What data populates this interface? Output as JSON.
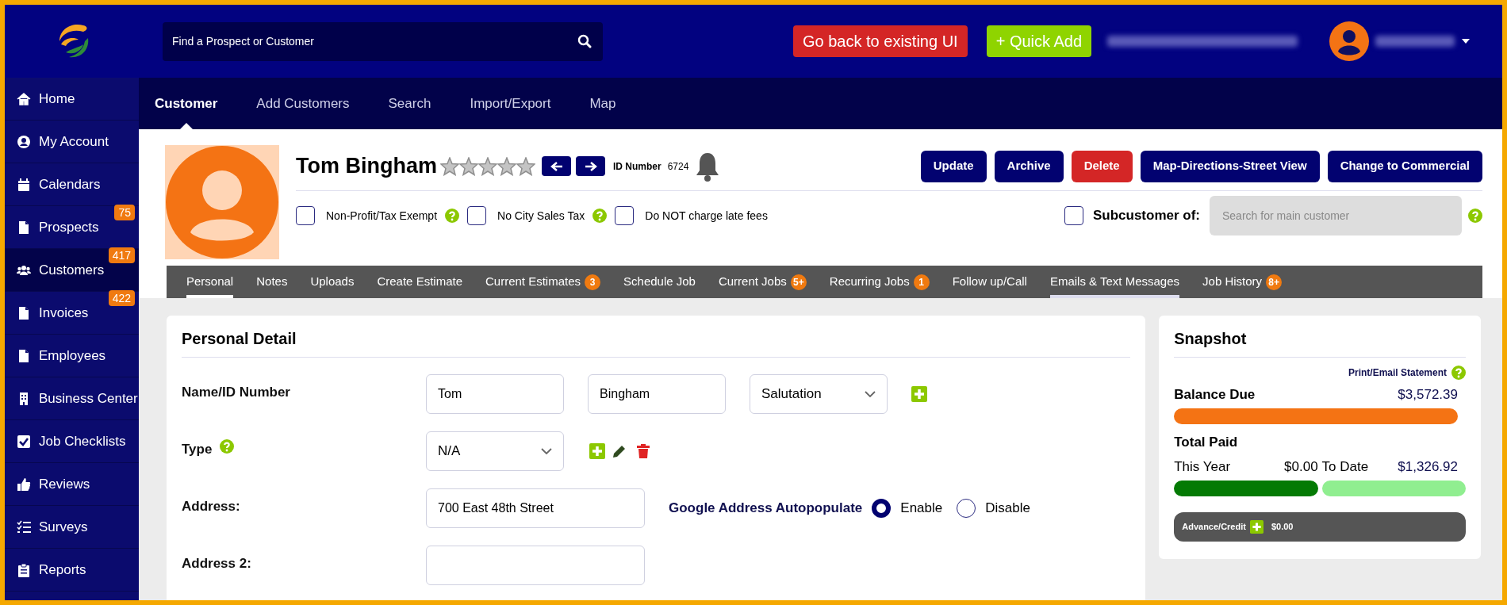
{
  "search": {
    "placeholder": "Find a Prospect or Customer"
  },
  "header_buttons": [
    {
      "label": "Go back to existing UI",
      "kind": "danger"
    },
    {
      "label": "+ Quick Add",
      "kind": "add"
    }
  ],
  "sidebar": {
    "items": [
      {
        "label": "Home",
        "selected": false
      },
      {
        "label": "My Account",
        "selected": false
      },
      {
        "label": "Calendars",
        "selected": false
      },
      {
        "label": "Prospects",
        "badge": "75",
        "selected": false
      },
      {
        "label": "Customers",
        "badge": "417",
        "selected": true
      },
      {
        "label": "Invoices",
        "badge": "422",
        "selected": false
      },
      {
        "label": "Employees",
        "selected": false
      },
      {
        "label": "Business Center",
        "selected": false
      },
      {
        "label": "Job Checklists",
        "selected": false
      },
      {
        "label": "Reviews",
        "selected": false
      },
      {
        "label": "Surveys",
        "selected": false
      },
      {
        "label": "Reports",
        "selected": false
      }
    ]
  },
  "subnav": [
    {
      "label": "Customer",
      "selected": true
    },
    {
      "label": "Add Customers",
      "selected": false
    },
    {
      "label": "Search",
      "selected": false
    },
    {
      "label": "Import/Export",
      "selected": false
    },
    {
      "label": "Map",
      "selected": false
    }
  ],
  "customer": {
    "name": "Tom Bingham",
    "stars": 0,
    "id_label": "ID Number",
    "id_value": "6724",
    "actions": [
      {
        "label": "Update",
        "kind": "primary"
      },
      {
        "label": "Archive",
        "kind": "primary"
      },
      {
        "label": "Delete",
        "kind": "danger"
      },
      {
        "label": "Map-Directions-Street View",
        "kind": "primary"
      },
      {
        "label": "Change to Commercial",
        "kind": "primary"
      }
    ],
    "options": [
      {
        "label": "Non-Profit/Tax Exempt",
        "checked": false,
        "help": true
      },
      {
        "label": "No City Sales Tax",
        "checked": false,
        "help": true
      },
      {
        "label": "Do NOT charge late fees",
        "checked": false,
        "help": false
      }
    ],
    "subcustomer": {
      "label": "Subcustomer of:",
      "checked": false,
      "placeholder": "Search for main customer"
    }
  },
  "tabs": [
    {
      "label": "Personal",
      "selected": true,
      "hovered": false
    },
    {
      "label": "Notes",
      "selected": false,
      "hovered": false
    },
    {
      "label": "Uploads",
      "selected": false,
      "hovered": false
    },
    {
      "label": "Create Estimate",
      "selected": false,
      "hovered": false
    },
    {
      "label": "Current Estimates",
      "badge": "3",
      "selected": false,
      "hovered": false
    },
    {
      "label": "Schedule Job",
      "selected": false,
      "hovered": false
    },
    {
      "label": "Current Jobs",
      "badge": "5+",
      "selected": false,
      "hovered": false
    },
    {
      "label": "Recurring Jobs",
      "badge": "1",
      "selected": false,
      "hovered": false
    },
    {
      "label": "Follow up/Call",
      "selected": false,
      "hovered": false
    },
    {
      "label": "Emails & Text Messages",
      "selected": false,
      "hovered": true
    },
    {
      "label": "Job History",
      "badge": "8+",
      "selected": false,
      "hovered": false
    }
  ],
  "personal_detail": {
    "title": "Personal Detail",
    "name_label": "Name/ID Number",
    "first_name": "Tom",
    "last_name": "Bingham",
    "salutation": "Salutation",
    "type_label": "Type",
    "type_value": "N/A",
    "address_label": "Address:",
    "address": "700 East 48th Street",
    "autopopulate_label": "Google Address Autopopulate",
    "autopopulate_options": [
      {
        "label": "Enable",
        "selected": true
      },
      {
        "label": "Disable",
        "selected": false
      }
    ],
    "address2_label": "Address 2:"
  },
  "snapshot": {
    "title": "Snapshot",
    "statement_link": "Print/Email Statement",
    "balance_label": "Balance Due",
    "balance": "$3,572.39",
    "total_paid_label": "Total Paid",
    "this_year_label": "This Year",
    "this_year": "$0.00",
    "to_date_label": "To Date",
    "to_date": "$1,326.92",
    "credit_label": "Advance/Credit",
    "credit": "$0.00"
  }
}
